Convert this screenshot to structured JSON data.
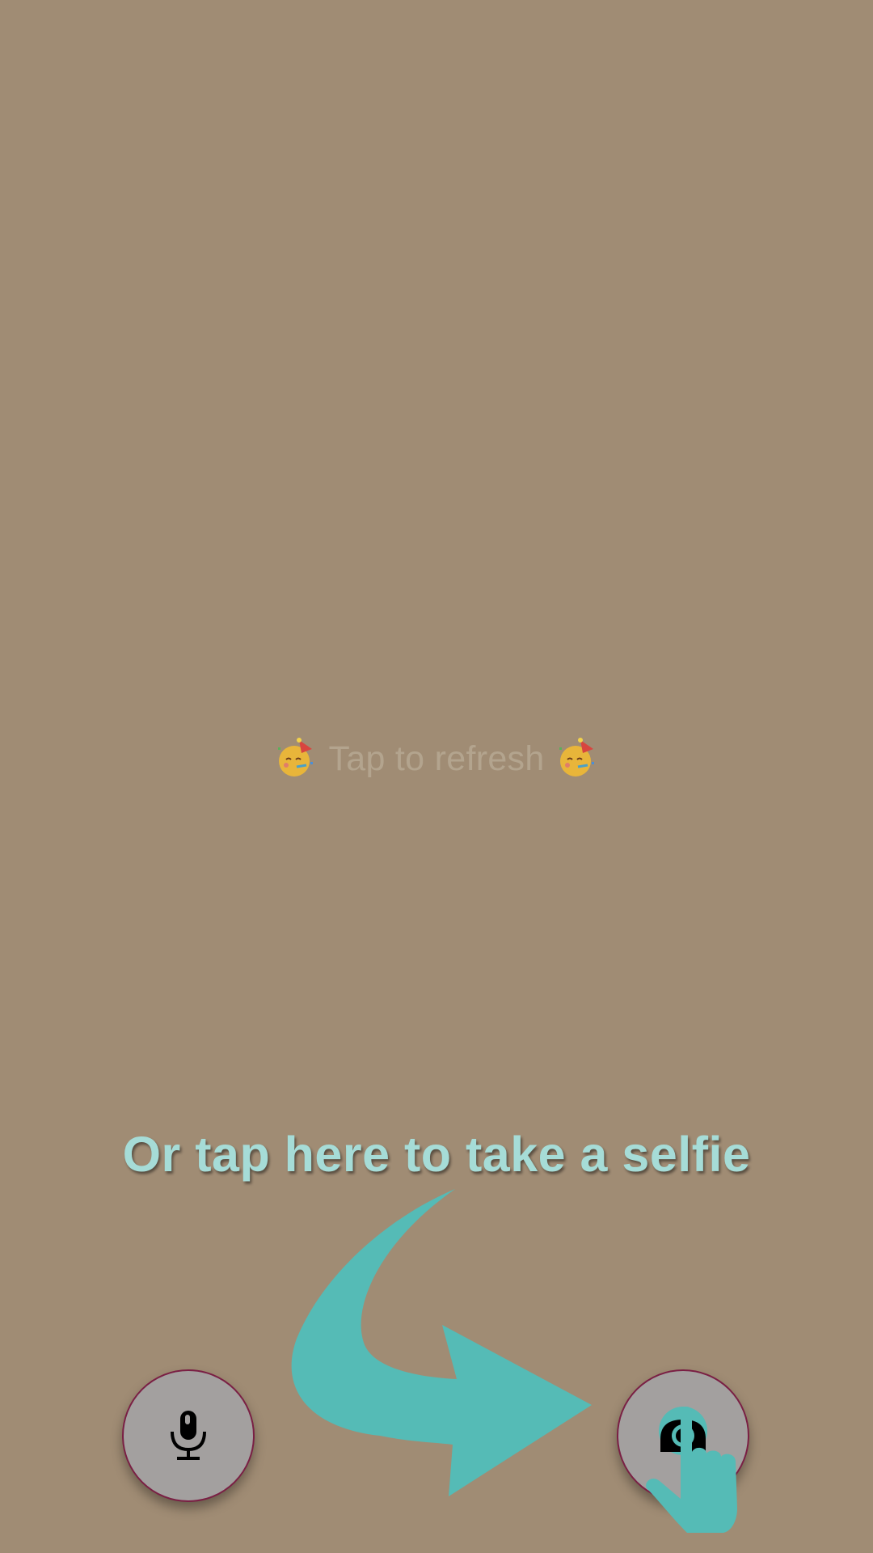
{
  "refresh": {
    "label": "Tap to refresh",
    "left_icon": "party-face-icon",
    "right_icon": "party-face-icon"
  },
  "hint": {
    "text": "Or tap here to take a selfie"
  },
  "buttons": {
    "mic_icon": "microphone-icon",
    "camera_icon": "camera-switch-icon"
  },
  "colors": {
    "background": "#a08c74",
    "accent_teal": "#55bbb6",
    "hint_text": "#a6dcd7",
    "button_fill": "#a3a09f",
    "button_border": "#7a1f44"
  }
}
